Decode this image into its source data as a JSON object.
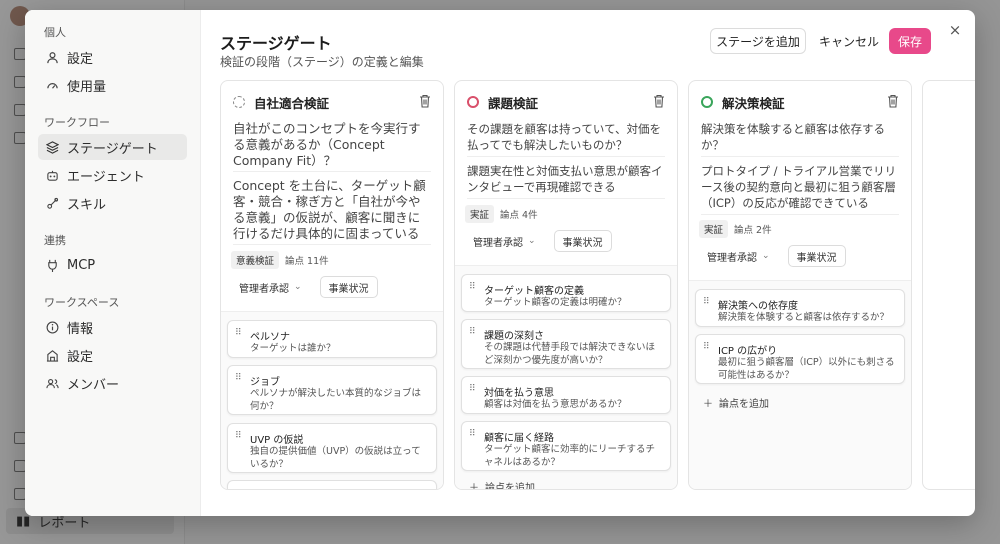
{
  "background": {
    "report_label": "レポート"
  },
  "settings_nav": {
    "sections": [
      {
        "title": "個人",
        "items": [
          {
            "label": "設定",
            "icon": "user-icon"
          },
          {
            "label": "使用量",
            "icon": "gauge-icon"
          }
        ]
      },
      {
        "title": "ワークフロー",
        "items": [
          {
            "label": "ステージゲート",
            "icon": "stage-gate-icon",
            "active": true
          },
          {
            "label": "エージェント",
            "icon": "bot-icon"
          },
          {
            "label": "スキル",
            "icon": "skill-icon"
          }
        ]
      },
      {
        "title": "連携",
        "items": [
          {
            "label": "MCP",
            "icon": "plug-icon"
          }
        ]
      },
      {
        "title": "ワークスペース",
        "items": [
          {
            "label": "情報",
            "icon": "info-icon"
          },
          {
            "label": "設定",
            "icon": "building-icon"
          },
          {
            "label": "メンバー",
            "icon": "users-icon"
          }
        ]
      }
    ]
  },
  "header": {
    "title": "ステージゲート",
    "subtitle": "検証の段階（ステージ）の定義と編集",
    "add_stage_label": "ステージを追加",
    "cancel_label": "キャンセル",
    "save_label": "保存",
    "close_glyph": "×"
  },
  "colors": {
    "accent": "#e8498a",
    "stage1_status": "#888888",
    "stage2_status": "#d9506b",
    "stage3_status": "#3aa55b"
  },
  "stages": [
    {
      "name": "自社適合検証",
      "question": "自社がこのコンセプトを今実行する意義があるか（Concept Company Fit）？",
      "criteria": "Concept を土台に、ターゲット顧客・競合・稼ぎ方と「自社が今やる意義」の仮説が、顧客に聞きに行けるだけ具体的に固まっている",
      "tag": "意義検証",
      "point_count": "論点 11件",
      "approval": "管理者承認",
      "status_label": "事業状況",
      "points": [
        {
          "title": "ペルソナ",
          "desc": "ターゲットは誰か？"
        },
        {
          "title": "ジョブ",
          "desc": "ペルソナが解決したい本質的なジョブは何か？"
        },
        {
          "title": "UVP の仮説",
          "desc": "独自の提供価値（UVP）の仮説は立っているか？"
        }
      ]
    },
    {
      "name": "課題検証",
      "question": "その課題を顧客は持っていて、対価を払ってでも解決したいものか？",
      "criteria": "課題実在性と対価支払い意思が顧客インタビューで再現確認できる",
      "tag": "実証",
      "point_count": "論点 4件",
      "approval": "管理者承認",
      "status_label": "事業状況",
      "points": [
        {
          "title": "ターゲット顧客の定義",
          "desc": "ターゲット顧客の定義は明確か？"
        },
        {
          "title": "課題の深刻さ",
          "desc": "その課題は代替手段では解決できないほど深刻かつ優先度が高いか？"
        },
        {
          "title": "対価を払う意思",
          "desc": "顧客は対価を払う意思があるか？"
        },
        {
          "title": "顧客に届く経路",
          "desc": "ターゲット顧客に効率的にリーチするチャネルはあるか？"
        }
      ],
      "add_point_label": "論点を追加"
    },
    {
      "name": "解決策検証",
      "question": "解決策を体験すると顧客は依存するか？",
      "criteria": "プロトタイプ / トライアル営業でリリース後の契約意向と最初に狙う顧客層（ICP）の反応が確認できている",
      "tag": "実証",
      "point_count": "論点 2件",
      "approval": "管理者承認",
      "status_label": "事業状況",
      "points": [
        {
          "title": "解決策への依存度",
          "desc": "解決策を体験すると顧客は依存するか？"
        },
        {
          "title": "ICP の広がり",
          "desc": "最初に狙う顧客層（ICP）以外にも刺さる可能性はあるか？"
        }
      ],
      "add_point_label": "論点を追加"
    }
  ]
}
